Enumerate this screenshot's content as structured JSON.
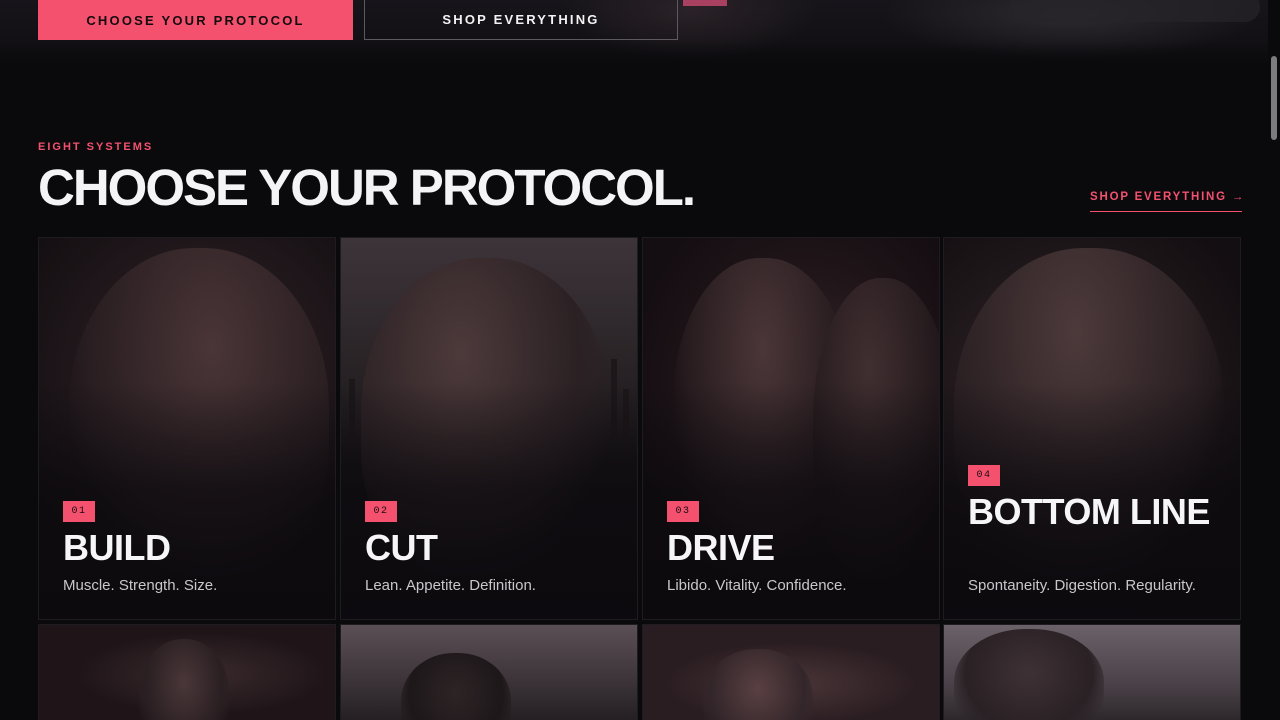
{
  "hero": {
    "primary_cta": "CHOOSE YOUR PROTOCOL",
    "secondary_cta": "SHOP EVERYTHING"
  },
  "section": {
    "eyebrow": "EIGHT SYSTEMS",
    "title": "CHOOSE YOUR PROTOCOL.",
    "shop_link": "SHOP EVERYTHING →"
  },
  "colors": {
    "accent": "#f4516f",
    "background": "#0a0a0d",
    "text": "#f4f4f6"
  },
  "cards": [
    {
      "number": "01",
      "title": "BUILD",
      "tagline": "Muscle. Strength. Size."
    },
    {
      "number": "02",
      "title": "CUT",
      "tagline": "Lean. Appetite. Definition."
    },
    {
      "number": "03",
      "title": "DRIVE",
      "tagline": "Libido. Vitality. Confidence."
    },
    {
      "number": "04",
      "title": "BOTTOM LINE",
      "tagline": "Spontaneity. Digestion. Regularity."
    }
  ]
}
